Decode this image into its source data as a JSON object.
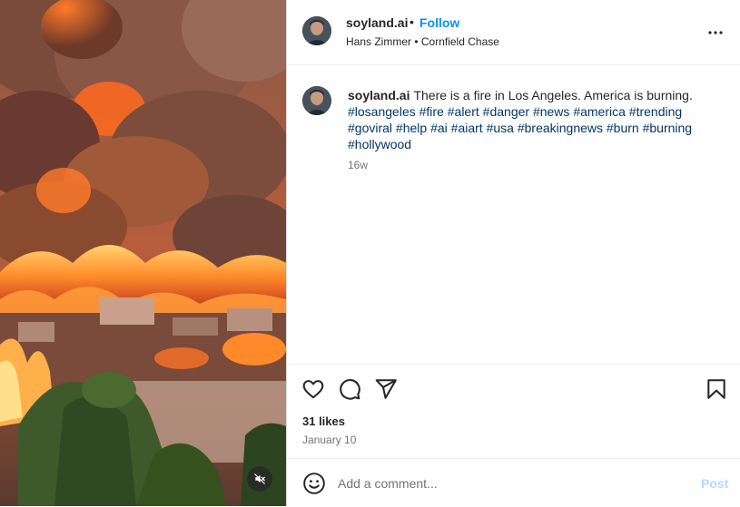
{
  "post": {
    "author": {
      "username": "soyland.ai",
      "separator": "•",
      "follow_label": "Follow",
      "audio": "Hans Zimmer • Cornfield Chase"
    },
    "caption": {
      "username": "soyland.ai",
      "text": "There is a fire in Los Angeles. America is burning.",
      "hashtags": [
        "#losangeles",
        "#fire",
        "#alert",
        "#danger",
        "#news",
        "#america",
        "#trending",
        "#goviral",
        "#help",
        "#ai",
        "#aiart",
        "#usa",
        "#breakingnews",
        "#burn",
        "#burning",
        "#hollywood"
      ],
      "time_ago": "16w"
    },
    "likes": "31 likes",
    "date": "January 10"
  },
  "comment": {
    "placeholder": "Add a comment...",
    "post_label": "Post"
  },
  "colors": {
    "link_blue": "#0095f6",
    "hashtag": "#00376b",
    "post_disabled": "#b3dbff",
    "muted_text": "#737373"
  },
  "icons": {
    "more": "more-horizontal-icon",
    "like": "heart-icon",
    "comment": "comment-icon",
    "share": "paper-plane-icon",
    "save": "bookmark-icon",
    "emoji": "smiley-icon",
    "mute": "speaker-muted-icon"
  }
}
